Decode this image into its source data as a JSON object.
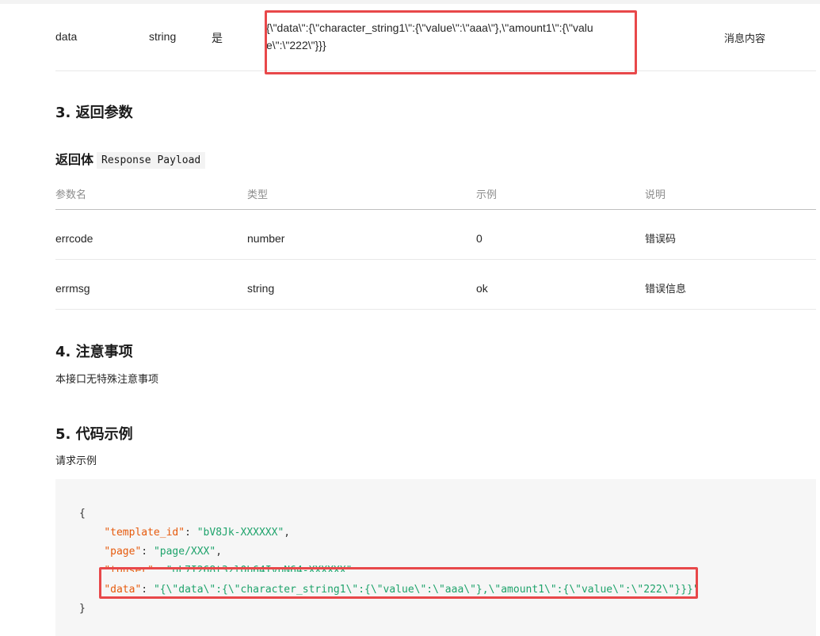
{
  "param_row": {
    "name": "data",
    "type": "string",
    "required": "是",
    "example": "{\\\"data\\\":{\\\"character_string1\\\":{\\\"value\\\":\\\"aaa\\\"},\\\"amount1\\\":{\\\"value\\\":\\\"222\\\"}}}",
    "desc": "消息内容"
  },
  "section3": {
    "title": "3. 返回参数",
    "sub_title": "返回体",
    "sub_code": "Response Payload"
  },
  "response_table": {
    "headers": [
      "参数名",
      "类型",
      "示例",
      "说明"
    ],
    "rows": [
      [
        "errcode",
        "number",
        "0",
        "错误码"
      ],
      [
        "errmsg",
        "string",
        "ok",
        "错误信息"
      ]
    ]
  },
  "section4": {
    "title": "4. 注意事项",
    "text": "本接口无特殊注意事项"
  },
  "section5": {
    "title": "5. 代码示例",
    "text": "请求示例"
  },
  "code": {
    "open_brace": "{",
    "close_brace": "}",
    "lines": [
      {
        "key": "\"template_id\"",
        "sep": ": ",
        "value": "\"bV8Jk-XXXXXX\"",
        "tail": ","
      },
      {
        "key": "\"page\"",
        "sep": ": ",
        "value": "\"page/XXX\"",
        "tail": ","
      },
      {
        "key": "\"touser\"",
        "sep": ": ",
        "value": "\"oL7I268t3zlQb64IvpN64-XXXXXX\"",
        "tail": ","
      },
      {
        "key": "\"data\"",
        "sep": ": ",
        "value": "\"{\\\"data\\\":{\\\"character_string1\\\":{\\\"value\\\":\\\"aaa\\\"},\\\"amount1\\\":{\\\"value\\\":\\\"222\\\"}}}\"",
        "tail": ""
      }
    ]
  },
  "colors": {
    "highlight_box": "#e8484a",
    "json_key": "#e65a0c",
    "json_string": "#1ea36b"
  }
}
